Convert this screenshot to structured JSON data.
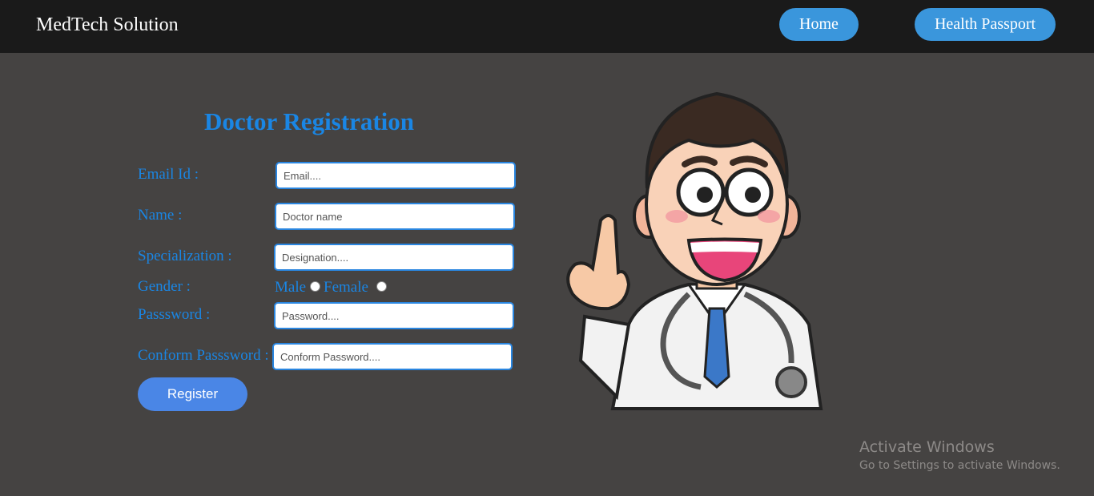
{
  "header": {
    "brand": "MedTech Solution",
    "nav": {
      "home": "Home",
      "passport": "Health Passport"
    }
  },
  "form": {
    "title": "Doctor Registration",
    "email_label": "Email Id :",
    "email_placeholder": "Email....",
    "name_label": "Name :",
    "name_placeholder": "Doctor name",
    "specialization_label": "Specialization :",
    "specialization_placeholder": "Designation....",
    "gender_label": "Gender :",
    "gender_male": "Male",
    "gender_female": "Female",
    "password_label": "Passsword :",
    "password_placeholder": "Password....",
    "confirm_label": "Conform Passsword :",
    "confirm_placeholder": "Conform Password....",
    "register": "Register"
  },
  "illustration": {
    "icon": "doctor-illustration"
  },
  "watermark": {
    "title": "Activate Windows",
    "subtitle": "Go to Settings to activate Windows."
  },
  "colors": {
    "accent": "#1a86e4",
    "button": "#3a96dc",
    "background": "#454342",
    "topbar": "#1a1a1a"
  }
}
